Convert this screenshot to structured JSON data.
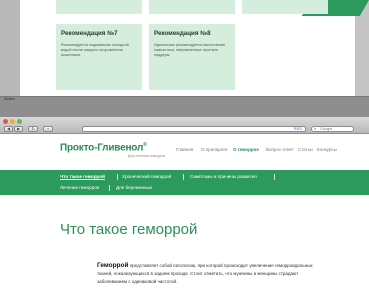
{
  "recommendations": {
    "card1": {
      "title": "Рекомендация №7",
      "text": "Рекомендуется подмывание холодной водой после каждого опорожнения кишечника."
    },
    "card2": {
      "title": "Рекомендация №8",
      "text": "Идеальным рекомендуется выполнение гимнастики, направленные прогнуть поддерж."
    }
  },
  "separator_label": "Мобил",
  "browser": {
    "back": "◀",
    "forward": "▶",
    "reload": "↻",
    "bookmark": "+",
    "search_placeholder": "Google",
    "rss": "RSS"
  },
  "site": {
    "logo": "Прокто-Гливенол",
    "logo_reg": "®",
    "logo_subtitle": "Для лечения геморроя",
    "topnav": [
      "Главная",
      "О препарате",
      "О геморрое",
      "Вопрос-ответ",
      "Статьи",
      "Конкурсы"
    ],
    "topnav_active_index": 2,
    "subnav": [
      "Что такое геморрой",
      "Хронический геморрой",
      "Симптомы и причины развития",
      "Лечение геморроя",
      "Для беременных"
    ],
    "subnav_active_index": 0,
    "page_title": "Что такое геморрой",
    "intro_bold": "Геморрой",
    "intro_text": " представляет собой патологию, при которой происходит увеличение геморроидальных тканей, локализующихся в заднем проходе. Стоит отметить, что мужчины и женщины страдают заболеванием с одинаковой частотой."
  },
  "colors": {
    "brand_green": "#2c9a5d",
    "card_bg": "#d4eddd",
    "title_green": "#2f8f58"
  }
}
